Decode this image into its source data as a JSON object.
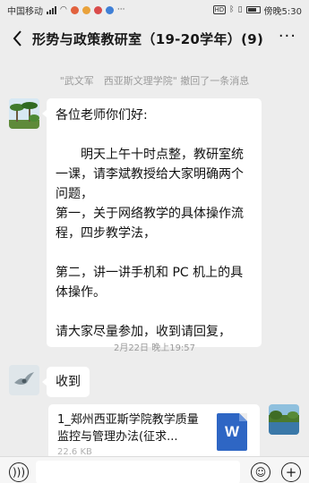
{
  "status_bar": {
    "carrier": "中国移动",
    "time_label": "傍晚5:30",
    "hd_badge": "HD"
  },
  "header": {
    "title": "形势与政策教研室（19-20学年）(9)",
    "back_icon": "chevron-left-icon",
    "more_label": "···"
  },
  "system_message": "\"武文军　西亚斯文理学院\" 撤回了一条消息",
  "messages": [
    {
      "lines": [
        "各位老师你们好:",
        "",
        "明天上午十时点整，教研室统一课，请李斌教授给大家明确两个问题，",
        "第一，关于网络教学的具体操作流程，四步教学法，",
        "",
        "第二，讲一讲手机和 PC 机上的具体操作。",
        "",
        "请大家尽量参加，收到请回复，"
      ]
    },
    {
      "text": "收到"
    }
  ],
  "timestamp": "2月22日 晚上19:57",
  "file_message": {
    "name": "1_郑州西亚斯学院教学质量监控与管理办法(征求...",
    "size": "22.6 KB",
    "icon_letter": "W"
  },
  "colors": {
    "background": "#ededed",
    "bubble": "#ffffff",
    "word_blue": "#2e66c4"
  }
}
